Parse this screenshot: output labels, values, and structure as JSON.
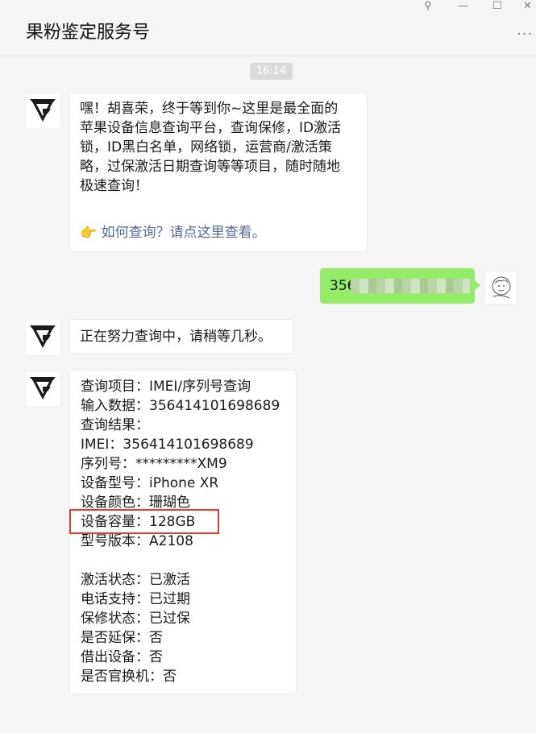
{
  "header": {
    "title": "果粉鉴定服务号"
  },
  "window_controls": {
    "pin": "⚲",
    "minimize": "—",
    "maximize": "☐",
    "close": "✕"
  },
  "timestamp": "16:14",
  "messages": {
    "welcome": {
      "lines": [
        "嘿！胡喜荣，终于等到你~这里是最全面的",
        "苹果设备信息查询平台，查询保修，ID激活",
        "锁，ID黑白名单，网络锁，运营商/激活策",
        "略，过保激活日期查询等等项目，随时随地",
        "极速查询！"
      ],
      "link_icon": "👉",
      "link_text": "如何查询？请点这里查看。"
    },
    "sent": {
      "visible_text": "356"
    },
    "waiting": {
      "text": "正在努力查询中，请稍等几秒。"
    },
    "result": {
      "rows": [
        "查询项目：IMEI/序列号查询",
        "输入数据：356414101698689",
        "查询结果：",
        "IMEI：356414101698689",
        "序列号：*********XM9",
        "设备型号：iPhone XR",
        "设备颜色：珊瑚色",
        "设备容量：128GB",
        "型号版本：A2108",
        "",
        "激活状态：已激活",
        "电话支持：已过期",
        "保修状态：已过保",
        "是否延保：否",
        "借出设备：否",
        "是否官换机：否"
      ]
    }
  },
  "colors": {
    "sent_bubble": "#95ec69",
    "link": "#576b95",
    "highlight": "#e53935"
  }
}
